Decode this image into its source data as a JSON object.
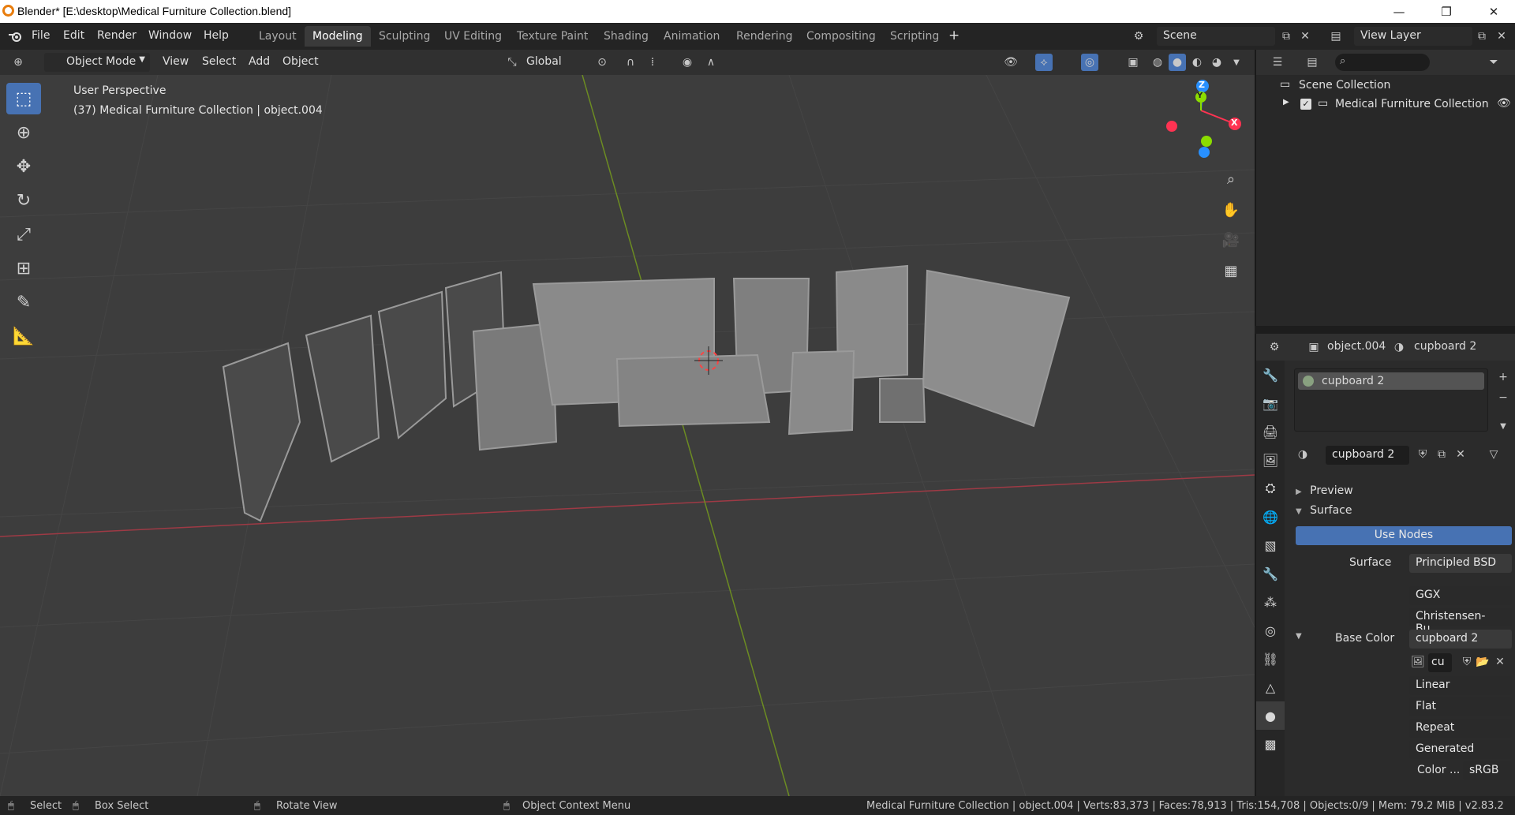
{
  "window": {
    "title": "Blender* [E:\\desktop\\Medical Furniture Collection.blend]",
    "minimize": "—",
    "restore": "❐",
    "close": "✕"
  },
  "menu": [
    "File",
    "Edit",
    "Render",
    "Window",
    "Help"
  ],
  "workspaces": {
    "tabs": [
      "Layout",
      "Modeling",
      "Sculpting",
      "UV Editing",
      "Texture Paint",
      "Shading",
      "Animation",
      "Rendering",
      "Compositing",
      "Scripting"
    ],
    "active": "Modeling",
    "add": "+"
  },
  "scene": {
    "name": "Scene",
    "view_layer": "View Layer"
  },
  "viewport_header": {
    "mode": "Object Mode",
    "menus": [
      "View",
      "Select",
      "Add",
      "Object"
    ],
    "orientation": "Global"
  },
  "viewport": {
    "perspective": "User Perspective",
    "context": "(37) Medical Furniture Collection | object.004",
    "axes": {
      "x": "X",
      "y": "Y",
      "z": "Z"
    }
  },
  "outliner": {
    "search_placeholder": "",
    "scene_collection": "Scene Collection",
    "collection": "Medical Furniture Collection"
  },
  "properties": {
    "object": "object.004",
    "material_header": "cupboard 2",
    "slot": "cupboard 2",
    "material_field": "cupboard 2",
    "sections": {
      "preview": "Preview",
      "surface": "Surface"
    },
    "use_nodes": "Use Nodes",
    "surface_label": "Surface",
    "surface_value": "Principled BSD",
    "distribution": "GGX",
    "subsurface": "Christensen-Bu...",
    "base_color_label": "Base Color",
    "base_color_value": "cupboard 2",
    "image_short": "cu",
    "interpolation": "Linear",
    "projection": "Flat",
    "extension": "Repeat",
    "source": "Generated",
    "color_label": "Color ...",
    "color_space": "sRGB"
  },
  "statusbar": {
    "select": "Select",
    "box_select": "Box Select",
    "rotate": "Rotate View",
    "context_menu": "Object Context Menu",
    "stats": "Medical Furniture Collection | object.004 | Verts:83,373 | Faces:78,913 | Tris:154,708 | Objects:0/9 | Mem: 79.2 MiB | v2.83.2"
  },
  "colors": {
    "accent": "#4772b3",
    "x_axis": "#ff3352",
    "y_axis": "#8bdc00",
    "z_axis": "#2890ff"
  }
}
